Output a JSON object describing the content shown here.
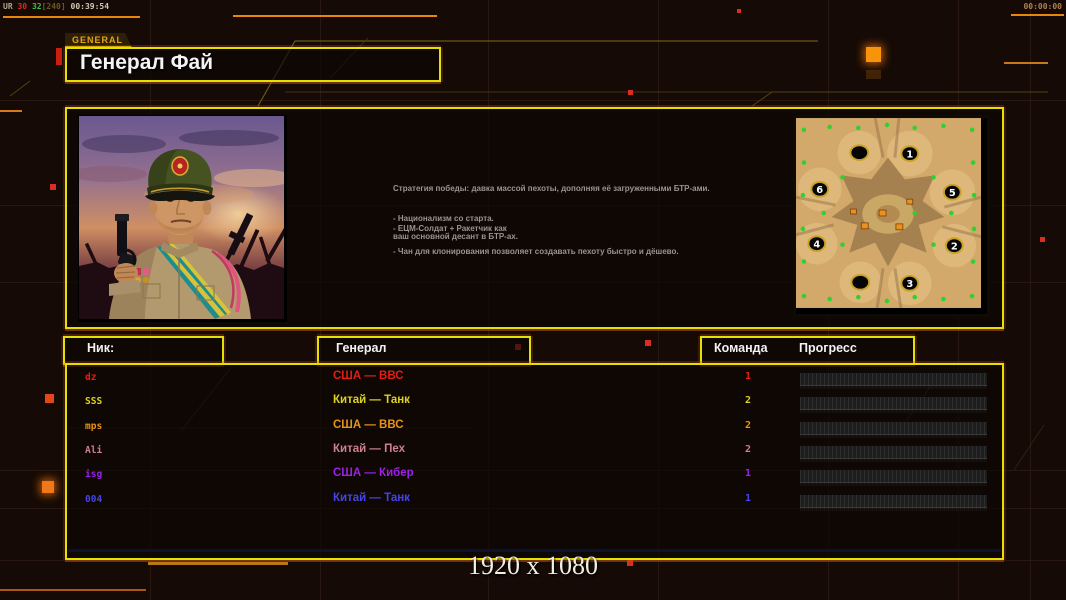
{
  "hud": {
    "top_left": {
      "label": "UR",
      "num_red": "30",
      "num_green": "32",
      "num_bracket": "[240]",
      "clock": "00:39:54"
    },
    "top_right_clock": "00:00:00",
    "resolution_label": "1920 x 1080"
  },
  "header": {
    "tab": "GENERAL",
    "title": "Генерал Фай"
  },
  "briefing": {
    "line1": "Стратегия победы: давка массой пехоты, дополняя её загруженными БТР-ами.",
    "line2": "- Национализм со старта.",
    "line3": "- ЕЦМ-Солдат + Ракетчик как",
    "line4": "ваш основной десант в БТР-ах.",
    "line5": "- Чан для клонирования позволяет создавать пехоту быстро и дёшево."
  },
  "minimap": {
    "marker_labels": [
      "1",
      "6",
      "5",
      "4",
      "2",
      "3"
    ]
  },
  "players": {
    "headers": {
      "nick": "Ник:",
      "general": "Генерал",
      "team": "Команда",
      "progress": "Прогресс"
    },
    "rows": [
      {
        "nick": "dz",
        "general": "США — ВВС",
        "team": "1",
        "progress_percent": 0,
        "color": "#e61d10"
      },
      {
        "nick": "SSS",
        "general": "Китай — Танк",
        "team": "2",
        "progress_percent": 0,
        "color": "#ddd31e"
      },
      {
        "nick": "mps",
        "general": "США — ВВС",
        "team": "2",
        "progress_percent": 0,
        "color": "#e89418"
      },
      {
        "nick": "Ali",
        "general": "Китай — Пех",
        "team": "2",
        "progress_percent": 0,
        "color": "#cf7f8e"
      },
      {
        "nick": "isg",
        "general": "США — Кибер",
        "team": "1",
        "progress_percent": 0,
        "color": "#9b21e8"
      },
      {
        "nick": "004",
        "general": "Китай — Танк",
        "team": "1",
        "progress_percent": 0,
        "color": "#4444e8"
      }
    ]
  },
  "colors": {
    "panel_border_yellow": "#e4e000",
    "accent_orange": "#e8860c",
    "alert_red": "#d83020",
    "map_dot_green": "#2fd12f"
  }
}
